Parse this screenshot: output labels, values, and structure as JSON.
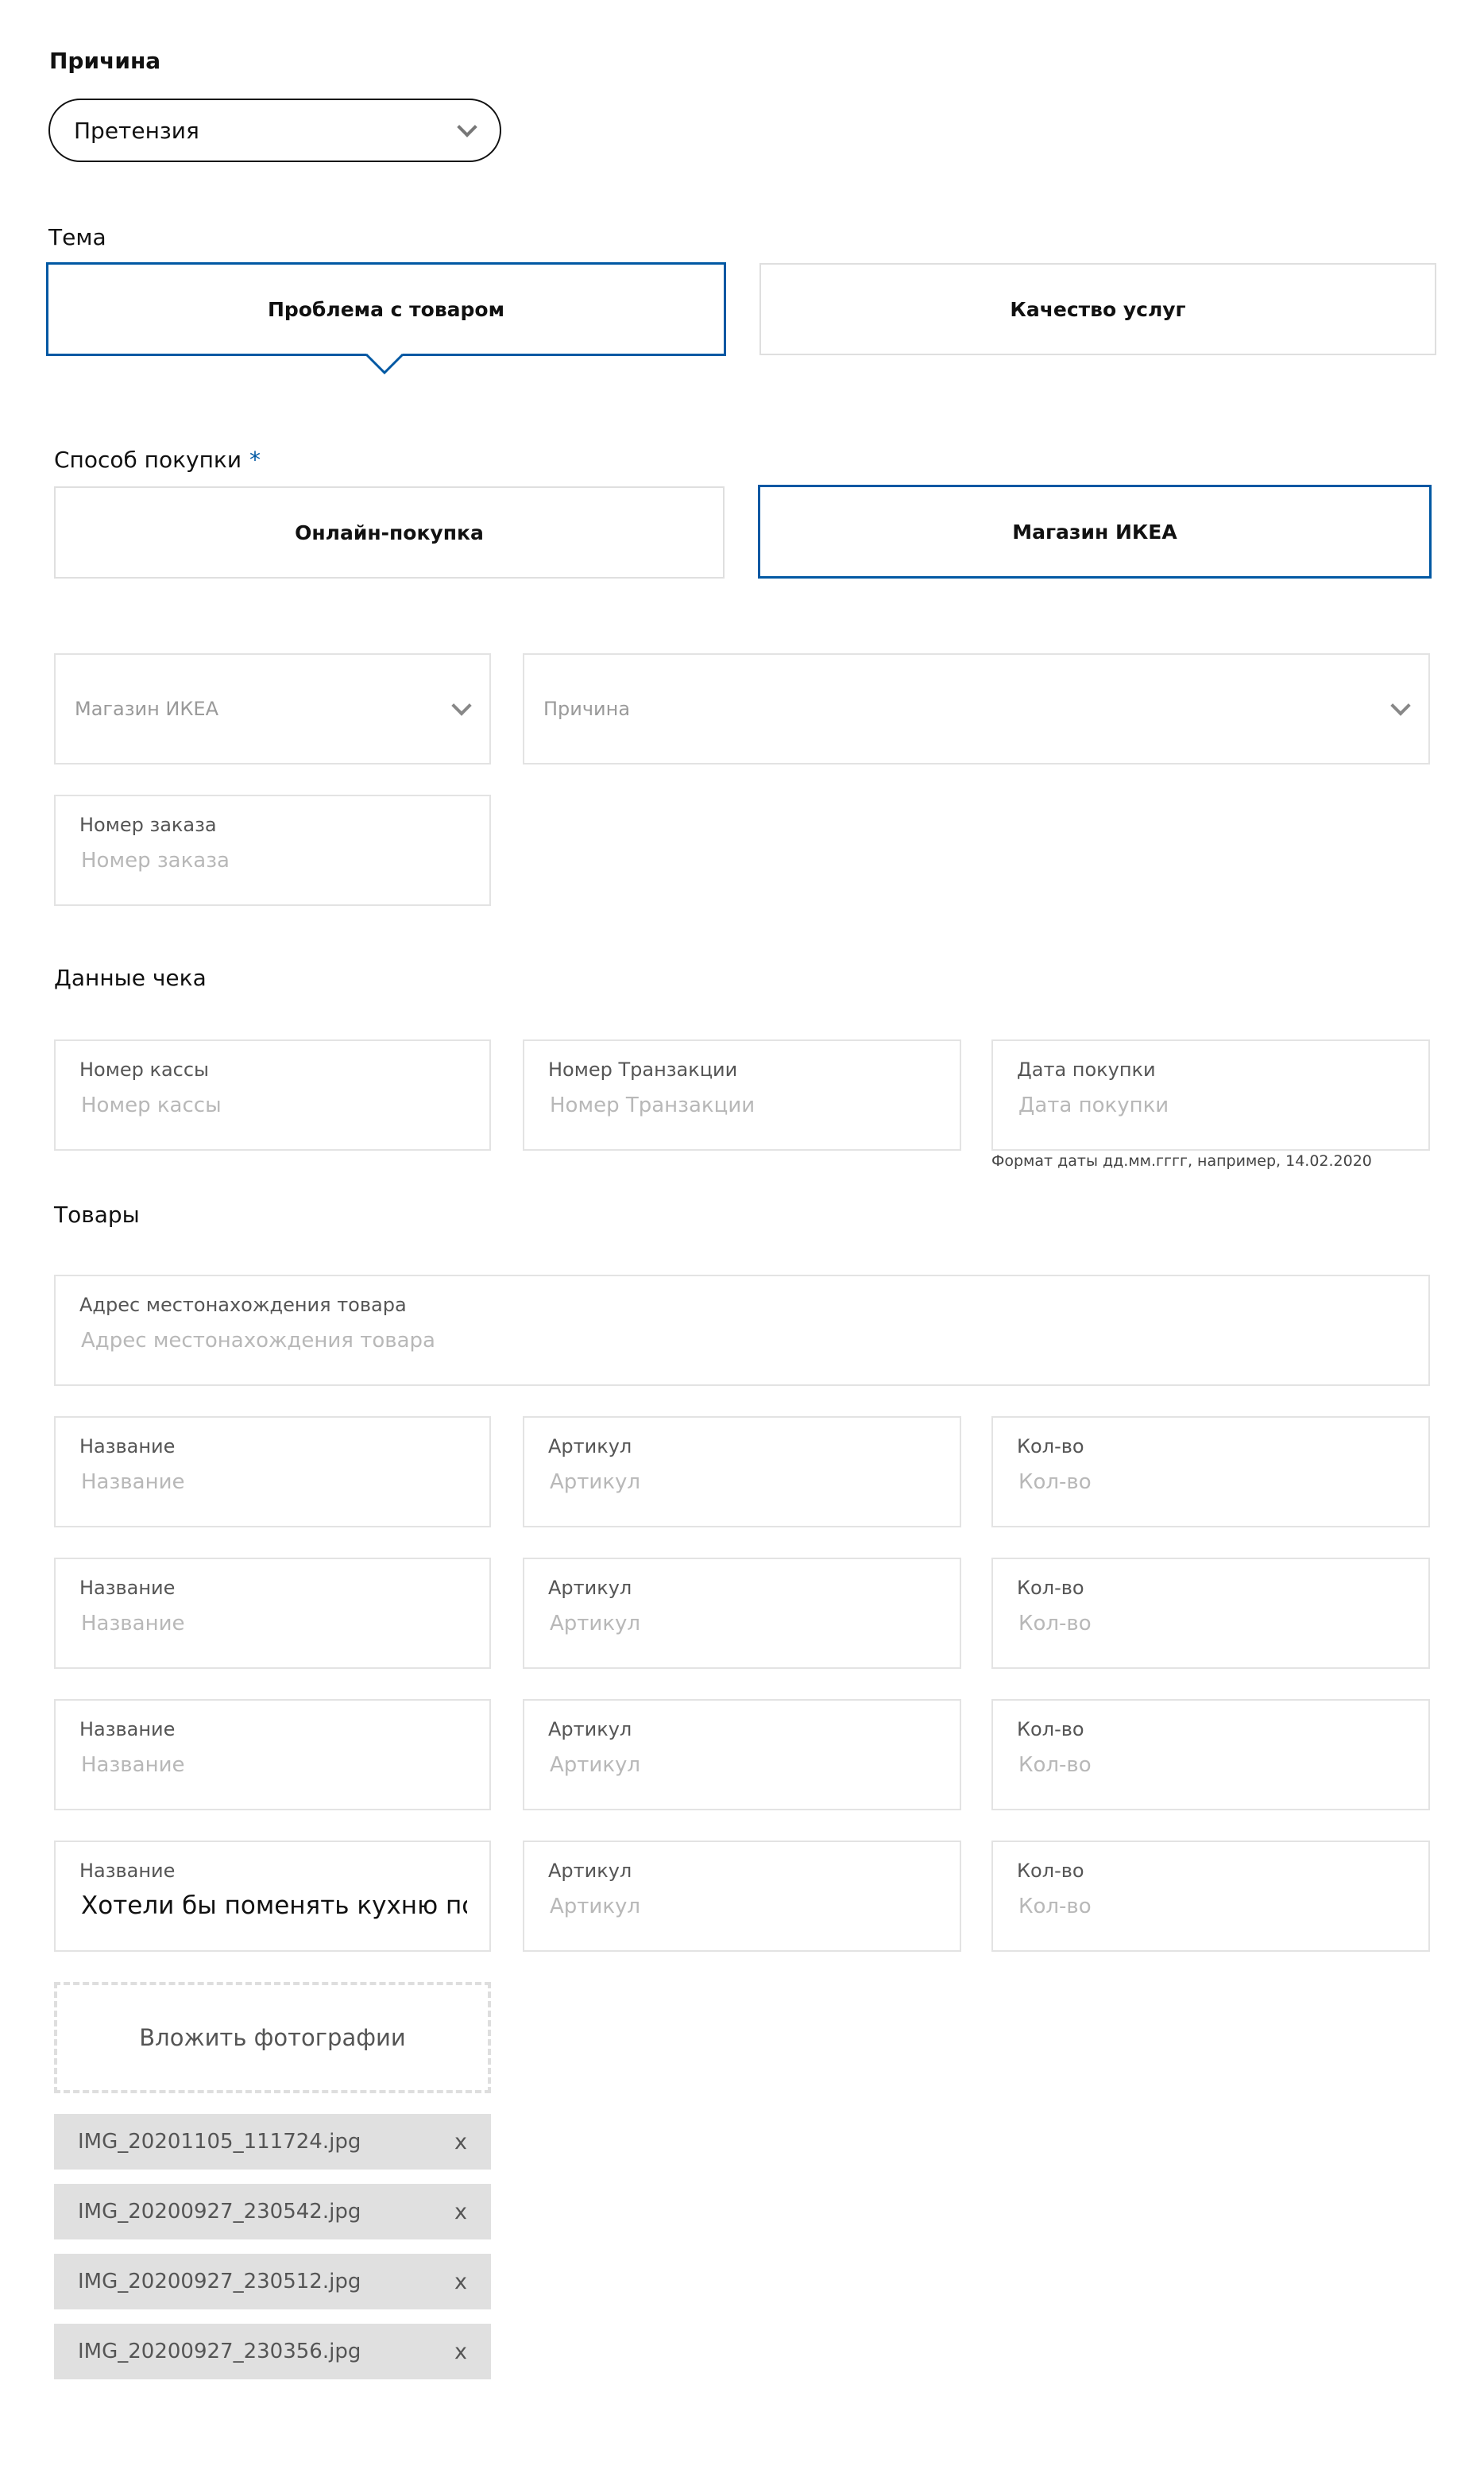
{
  "reason_select": {
    "label": "Причина",
    "value": "Претензия"
  },
  "topic": {
    "label": "Тема",
    "options": [
      {
        "label": "Проблема с товаром",
        "active": true
      },
      {
        "label": "Качество услуг",
        "active": false
      }
    ]
  },
  "purchase_method": {
    "label": "Способ покупки",
    "required_mark": "*",
    "options": [
      {
        "label": "Онлайн-покупка",
        "active": false
      },
      {
        "label": "Магазин ИКЕА",
        "active": true
      }
    ]
  },
  "store_select": {
    "placeholder": "Магазин ИКЕА"
  },
  "reason_dropdown": {
    "placeholder": "Причина"
  },
  "order_number": {
    "label": "Номер заказа",
    "placeholder": "Номер заказа",
    "value": ""
  },
  "receipt": {
    "title": "Данные чека",
    "register": {
      "label": "Номер кассы",
      "placeholder": "Номер кассы",
      "value": ""
    },
    "transaction": {
      "label": "Номер Транзакции",
      "placeholder": "Номер Транзакции",
      "value": ""
    },
    "date": {
      "label": "Дата покупки",
      "placeholder": "Дата покупки",
      "value": "",
      "hint": "Формат даты дд.мм.гггг, например, 14.02.2020"
    }
  },
  "goods": {
    "title": "Товары",
    "address": {
      "label": "Адрес местонахождения товара",
      "placeholder": "Адрес местонахождения товара",
      "value": ""
    },
    "rows": [
      {
        "name_label": "Название",
        "name_placeholder": "Название",
        "name_value": "",
        "sku_label": "Артикул",
        "sku_placeholder": "Артикул",
        "qty_label": "Кол-во",
        "qty_placeholder": "Кол-во"
      },
      {
        "name_label": "Название",
        "name_placeholder": "Название",
        "name_value": "",
        "sku_label": "Артикул",
        "sku_placeholder": "Артикул",
        "qty_label": "Кол-во",
        "qty_placeholder": "Кол-во"
      },
      {
        "name_label": "Название",
        "name_placeholder": "Название",
        "name_value": "",
        "sku_label": "Артикул",
        "sku_placeholder": "Артикул",
        "qty_label": "Кол-во",
        "qty_placeholder": "Кол-во"
      },
      {
        "name_label": "Название",
        "name_placeholder": "Название",
        "name_value": "Хотели бы поменять кухню по",
        "sku_label": "Артикул",
        "sku_placeholder": "Артикул",
        "qty_label": "Кол-во",
        "qty_placeholder": "Кол-во"
      }
    ]
  },
  "attachments": {
    "upload_label": "Вложить фотографии",
    "remove_label": "x",
    "files": [
      {
        "name": "IMG_20201105_111724.jpg"
      },
      {
        "name": "IMG_20200927_230542.jpg"
      },
      {
        "name": "IMG_20200927_230512.jpg"
      },
      {
        "name": "IMG_20200927_230356.jpg"
      }
    ]
  },
  "colors": {
    "accent": "#0058a3",
    "border": "#e3e3e3",
    "file_bg": "#e0e0e0"
  }
}
